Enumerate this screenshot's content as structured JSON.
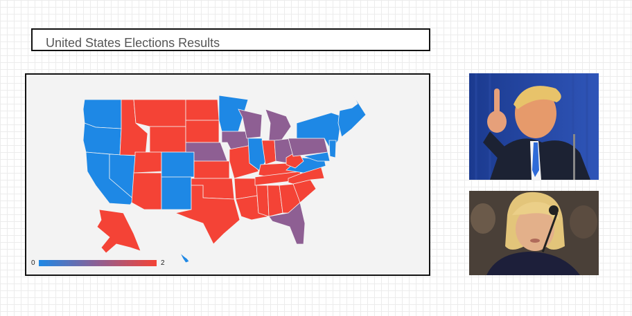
{
  "title": "United States Elections Results",
  "chart_data": {
    "type": "choropleth",
    "title": "",
    "color_scale": {
      "min": 0,
      "max": 2,
      "min_label": "0",
      "max_label": "2",
      "colors": [
        "#1e88e5",
        "#8e5f93",
        "#f44336"
      ]
    },
    "regions": [
      {
        "name": "Washington",
        "value": 0
      },
      {
        "name": "Oregon",
        "value": 0
      },
      {
        "name": "California",
        "value": 0
      },
      {
        "name": "Nevada",
        "value": 0
      },
      {
        "name": "Idaho",
        "value": 2
      },
      {
        "name": "Montana",
        "value": 2
      },
      {
        "name": "Wyoming",
        "value": 2
      },
      {
        "name": "Utah",
        "value": 2
      },
      {
        "name": "Arizona",
        "value": 2
      },
      {
        "name": "Colorado",
        "value": 0
      },
      {
        "name": "New Mexico",
        "value": 0
      },
      {
        "name": "North Dakota",
        "value": 2
      },
      {
        "name": "South Dakota",
        "value": 2
      },
      {
        "name": "Nebraska",
        "value": 1
      },
      {
        "name": "Kansas",
        "value": 2
      },
      {
        "name": "Oklahoma",
        "value": 2
      },
      {
        "name": "Texas",
        "value": 2
      },
      {
        "name": "Minnesota",
        "value": 0
      },
      {
        "name": "Iowa",
        "value": 1
      },
      {
        "name": "Missouri",
        "value": 2
      },
      {
        "name": "Arkansas",
        "value": 2
      },
      {
        "name": "Louisiana",
        "value": 2
      },
      {
        "name": "Wisconsin",
        "value": 1
      },
      {
        "name": "Illinois",
        "value": 0
      },
      {
        "name": "Michigan",
        "value": 1
      },
      {
        "name": "Indiana",
        "value": 2
      },
      {
        "name": "Ohio",
        "value": 1
      },
      {
        "name": "Kentucky",
        "value": 2
      },
      {
        "name": "Tennessee",
        "value": 2
      },
      {
        "name": "Mississippi",
        "value": 2
      },
      {
        "name": "Alabama",
        "value": 2
      },
      {
        "name": "Georgia",
        "value": 2
      },
      {
        "name": "Florida",
        "value": 1
      },
      {
        "name": "South Carolina",
        "value": 2
      },
      {
        "name": "North Carolina",
        "value": 2
      },
      {
        "name": "Virginia",
        "value": 0
      },
      {
        "name": "West Virginia",
        "value": 2
      },
      {
        "name": "Pennsylvania",
        "value": 1
      },
      {
        "name": "New York",
        "value": 0
      },
      {
        "name": "Maryland",
        "value": 0
      },
      {
        "name": "New Jersey",
        "value": 0
      },
      {
        "name": "New England",
        "value": 0
      },
      {
        "name": "Alaska",
        "value": 2
      },
      {
        "name": "Hawaii",
        "value": 0
      }
    ]
  }
}
